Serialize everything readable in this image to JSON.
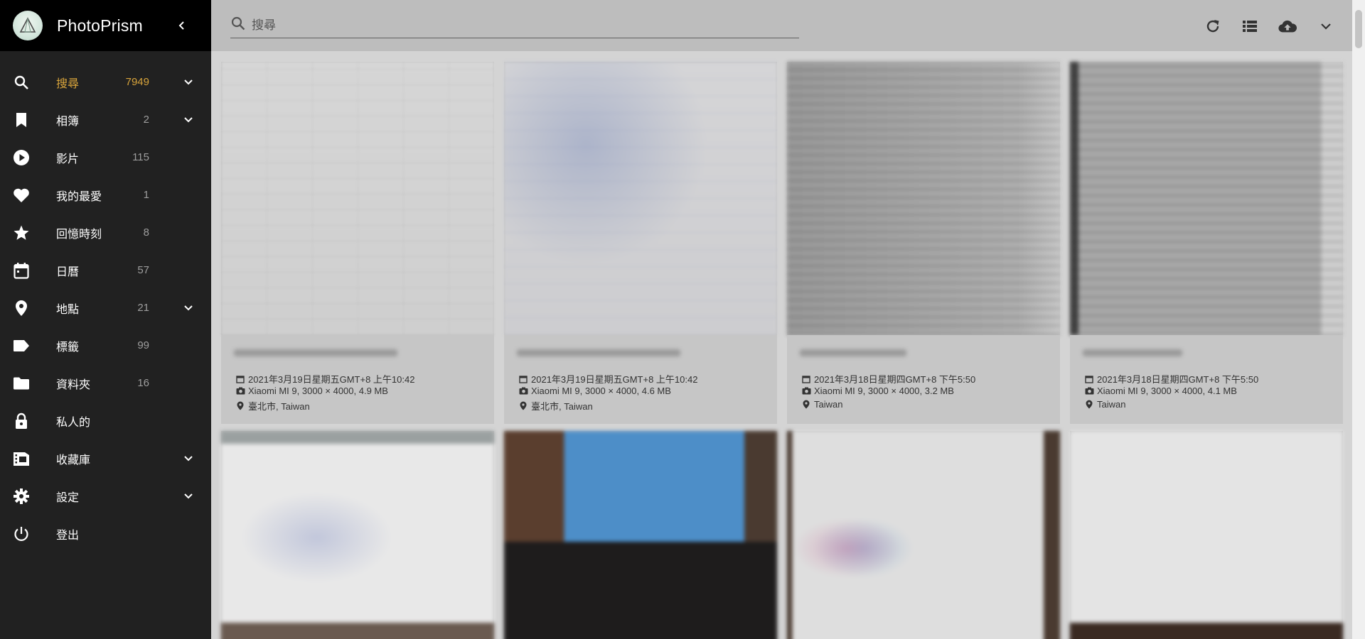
{
  "app": {
    "title": "PhotoPrism"
  },
  "sidebar": {
    "items": [
      {
        "label": "搜尋",
        "count": "7949",
        "icon": "search-icon",
        "expandable": true,
        "active": true
      },
      {
        "label": "相簿",
        "count": "2",
        "icon": "bookmark-icon",
        "expandable": true
      },
      {
        "label": "影片",
        "count": "115",
        "icon": "play-circle-icon",
        "expandable": false
      },
      {
        "label": "我的最愛",
        "count": "1",
        "icon": "heart-icon",
        "expandable": false
      },
      {
        "label": "回憶時刻",
        "count": "8",
        "icon": "star-icon",
        "expandable": false
      },
      {
        "label": "日曆",
        "count": "57",
        "icon": "calendar-icon",
        "expandable": false
      },
      {
        "label": "地點",
        "count": "21",
        "icon": "map-marker-icon",
        "expandable": true
      },
      {
        "label": "標籤",
        "count": "99",
        "icon": "label-icon",
        "expandable": false
      },
      {
        "label": "資料夾",
        "count": "16",
        "icon": "folder-icon",
        "expandable": false
      },
      {
        "label": "私人的",
        "count": "",
        "icon": "lock-icon",
        "expandable": false
      },
      {
        "label": "收藏庫",
        "count": "",
        "icon": "film-library-icon",
        "expandable": true
      },
      {
        "label": "設定",
        "count": "",
        "icon": "gear-icon",
        "expandable": true
      },
      {
        "label": "登出",
        "count": "",
        "icon": "power-icon",
        "expandable": false
      }
    ]
  },
  "search": {
    "placeholder": "搜尋"
  },
  "photos": [
    {
      "date": "2021年3月19日星期五GMT+8 上午10:42",
      "camera": "Xiaomi MI 9, 3000 × 4000, 4.9 MB",
      "location": "臺北市, Taiwan"
    },
    {
      "date": "2021年3月19日星期五GMT+8 上午10:42",
      "camera": "Xiaomi MI 9, 3000 × 4000, 4.6 MB",
      "location": "臺北市, Taiwan"
    },
    {
      "date": "2021年3月18日星期四GMT+8 下午5:50",
      "camera": "Xiaomi MI 9, 3000 × 4000, 3.2 MB",
      "location": "Taiwan"
    },
    {
      "date": "2021年3月18日星期四GMT+8 下午5:50",
      "camera": "Xiaomi MI 9, 3000 × 4000, 4.1 MB",
      "location": "Taiwan"
    }
  ],
  "colors": {
    "accent": "#d8a43b",
    "sidebar_bg": "#212121",
    "header_bg": "#000000",
    "overlay": "#bdbdbd"
  }
}
